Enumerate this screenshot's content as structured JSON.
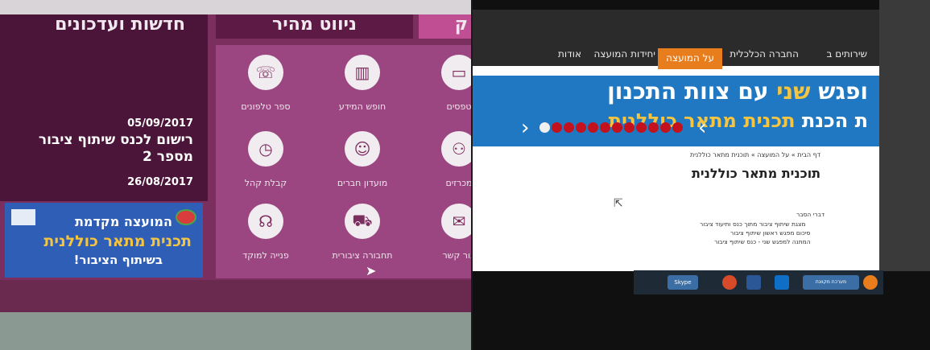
{
  "left": {
    "headers": {
      "news": "חדשות ועדכונים",
      "tiles": "ניווט מהיר",
      "corner": "ק"
    },
    "news": [
      {
        "date": "05/09/2017",
        "title": "רישום לכנס שיתוף ציבור מספר 2"
      },
      {
        "date": "26/08/2017"
      }
    ],
    "banner": {
      "line1": "המועצה מקדמת",
      "line2": "תכנית מתאר כוללנית",
      "line3": "בשיתוף הציבור!"
    },
    "tiles": [
      {
        "label": "ספר טלפונים",
        "icon": "☏"
      },
      {
        "label": "חופש המידע",
        "icon": "▥"
      },
      {
        "label": "טפסים",
        "icon": "▭"
      },
      {
        "label": "קבלת קהל",
        "icon": "◷"
      },
      {
        "label": "מועדון חברים",
        "icon": "☺"
      },
      {
        "label": "מכרזים",
        "icon": "⚇"
      },
      {
        "label": "פנייה למוקד",
        "icon": "☊"
      },
      {
        "label": "תחבורה ציבורית",
        "icon": "⛟"
      },
      {
        "label": "צור קשר",
        "icon": "✉"
      }
    ]
  },
  "right": {
    "nav": [
      "אודות",
      "יחידות המועצה",
      "על המועצה",
      "החברה הכלכלית",
      "שירותים ב"
    ],
    "hero": {
      "line1_pre": "ופגש",
      "line1_hl": "שני",
      "line1_post": "עם צוות התכנון",
      "line2_pre": "ת הכנת",
      "line2_hl": "תכנית מתאר כוללנית"
    },
    "breadcrumb": "דף הבית » על המועצה » תוכנית מתאר כוללנית",
    "page_title": "תוכנית מתאר כוללנית",
    "doc_lines": [
      "דברי הסבר",
      "מצגת שיתוף ציבור מתוך כנס ותיעוד ציבור",
      "סיכום מפגש ראשון שיתוף ציבור",
      "המתנה למפגש שני - כנס שיתוף ציבור"
    ],
    "taskbar": {
      "skype": "Skype",
      "ie": "מערכת מקוונת"
    }
  }
}
